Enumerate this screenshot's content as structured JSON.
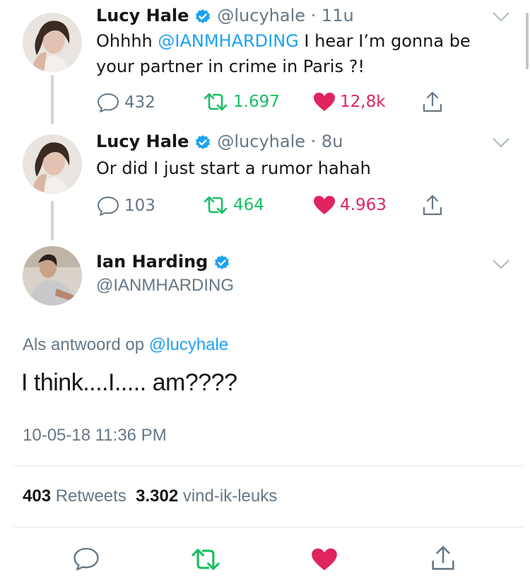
{
  "tweets": [
    {
      "name": "Lucy Hale",
      "handle": "@lucyhale",
      "time": "11u",
      "text_before": "Ohhhh ",
      "mention": "@IANMHARDING",
      "text_after": " I hear I’m gonna be your partner in crime in Paris ?!",
      "replies": "432",
      "retweets": "1.697",
      "likes": "12,8k"
    },
    {
      "name": "Lucy Hale",
      "handle": "@lucyhale",
      "time": "8u",
      "text": "Or did I just start a rumor hahah",
      "replies": "103",
      "retweets": "464",
      "likes": "4.963"
    }
  ],
  "main_tweet": {
    "name": "Ian Harding",
    "handle": "@IANMHARDING",
    "reply_prefix": "Als antwoord op",
    "reply_to": "@lucyhale",
    "text": "I think....I..... am????",
    "timestamp": "10-05-18 11:36 PM",
    "retweet_count": "403",
    "retweet_label": "Retweets",
    "like_count": "3.302",
    "like_label": "vind-ik-leuks"
  },
  "colors": {
    "brand_blue": "#1da1f2",
    "retweet_green": "#17bf63",
    "like_red": "#e0245e",
    "secondary_gray": "#657786"
  },
  "icons": [
    "verified-icon",
    "chevron-down-icon",
    "reply-icon",
    "retweet-icon",
    "heart-icon",
    "share-icon"
  ]
}
